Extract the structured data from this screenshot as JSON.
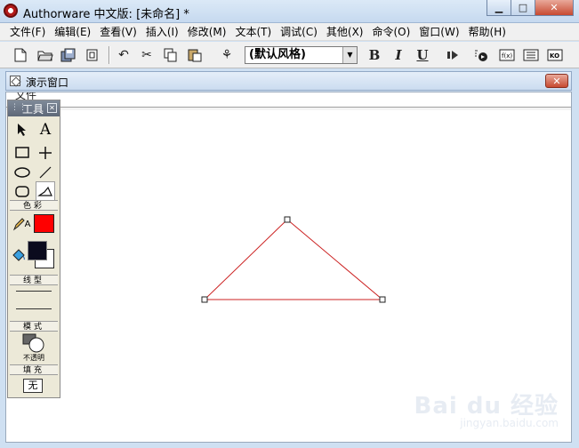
{
  "window": {
    "title": "Authorware 中文版: [未命名] *",
    "controls": [
      "minimize",
      "maximize",
      "close"
    ]
  },
  "menu": [
    "文件(F)",
    "编辑(E)",
    "查看(V)",
    "插入(I)",
    "修改(M)",
    "文本(T)",
    "调试(C)",
    "其他(X)",
    "命令(O)",
    "窗口(W)",
    "帮助(H)"
  ],
  "toolbar": {
    "style_value": "(默认风格)",
    "bold": "B",
    "italic": "I",
    "underline": "U"
  },
  "presentation": {
    "title": "演示窗口",
    "ghost_menu": "文件"
  },
  "palette": {
    "title": "工具",
    "sections": {
      "color": "色彩",
      "line": "线型",
      "mode": "模式",
      "fill": "填充"
    },
    "text_tool": "A",
    "line_color_label": "A",
    "mode_label": "不透明",
    "fill_label": "无",
    "colors": {
      "line_color": "#ff0000",
      "foreground": "#0b0b1e",
      "background": "#ffffff"
    }
  },
  "shape": {
    "type": "triangle",
    "stroke": "#cc2222"
  },
  "watermark": {
    "brand": "Bai du 经验",
    "url": "jingyan.baidu.com"
  }
}
